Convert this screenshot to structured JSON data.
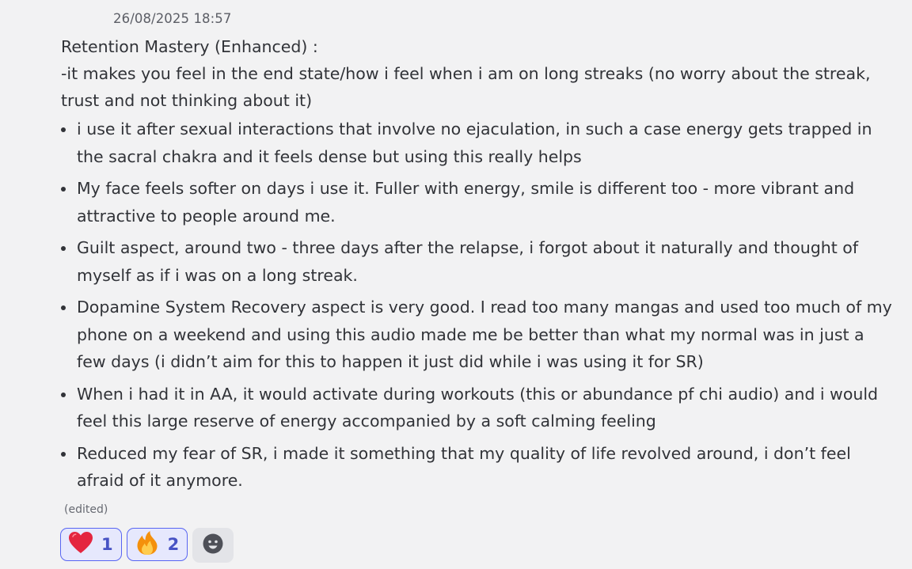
{
  "message": {
    "timestamp": "26/08/2025 18:57",
    "heading": "Retention Mastery (Enhanced) :",
    "intro_line_1": "-it makes you feel in the end state/how i feel when i am on long streaks (no worry about the streak,",
    "intro_line_2": "trust and not thinking about it)",
    "bullets": [
      {
        "line_1": "i use it after sexual interactions that involve no ejaculation, in such a case energy gets trapped in",
        "line_2": "the sacral chakra and it feels dense but using this really helps"
      },
      {
        "line_1": "My face feels softer on days i use it. Fuller with energy, smile is different too - more vibrant and",
        "line_2": "attractive to people around me."
      },
      {
        "line_1": "Guilt aspect, around two - three days after the relapse, i forgot about it naturally and thought of",
        "line_2": "myself as if i was on a long streak."
      },
      {
        "line_1": "Dopamine System Recovery aspect is very good. I read too many mangas and used too much of my",
        "line_2": "phone on a weekend and using this audio made me be better than what my normal was in just a",
        "line_3": "few days (i didn’t aim for this to happen it just did while i was using it for SR)"
      },
      {
        "line_1": "When i had it in AA, it would activate during workouts (this or abundance pf chi audio) and i would",
        "line_2": "feel this large reserve of energy accompanied by a soft calming feeling"
      },
      {
        "line_1": "Reduced my fear of SR, i made it something that my quality of life revolved around, i don’t feel",
        "line_2": "afraid of it anymore."
      }
    ],
    "edited_label": "(edited)"
  },
  "reactions": [
    {
      "icon": "heart-icon",
      "count": "1"
    },
    {
      "icon": "fire-icon",
      "count": "2"
    }
  ],
  "add_reaction_icon": "add-reaction-icon",
  "colors": {
    "background": "#f2f2f3",
    "accent": "#5865f2",
    "reaction_bg": "#e6e8fd",
    "reaction_count": "#4752c4",
    "heart": "#e4253f"
  }
}
